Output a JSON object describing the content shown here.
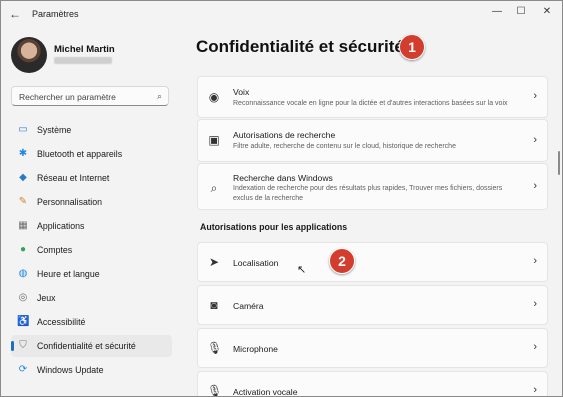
{
  "window": {
    "title": "Paramètres",
    "back_glyph": "←",
    "minimize_glyph": "—",
    "maximize_glyph": "☐",
    "close_glyph": "✕"
  },
  "user": {
    "name": "Michel Martin"
  },
  "search": {
    "placeholder": "Rechercher un paramètre"
  },
  "sidebar": {
    "items": [
      {
        "label": "Système",
        "icon": "monitor-icon",
        "glyph": "▭",
        "color": "#2d7fd3"
      },
      {
        "label": "Bluetooth et appareils",
        "icon": "bluetooth-icon",
        "glyph": "✱",
        "color": "#1e88e5"
      },
      {
        "label": "Réseau et Internet",
        "icon": "wifi-icon",
        "glyph": "◆",
        "color": "#2a79c9"
      },
      {
        "label": "Personnalisation",
        "icon": "brush-icon",
        "glyph": "✎",
        "color": "#d9822b"
      },
      {
        "label": "Applications",
        "icon": "apps-icon",
        "glyph": "▦",
        "color": "#6b6b6b"
      },
      {
        "label": "Comptes",
        "icon": "person-icon",
        "glyph": "●",
        "color": "#2fa35f"
      },
      {
        "label": "Heure et langue",
        "icon": "globe-clock-icon",
        "glyph": "◍",
        "color": "#1e88e5"
      },
      {
        "label": "Jeux",
        "icon": "gamepad-icon",
        "glyph": "◎",
        "color": "#6b6b6b"
      },
      {
        "label": "Accessibilité",
        "icon": "accessibility-icon",
        "glyph": "♿",
        "color": "#1e88e5"
      },
      {
        "label": "Confidentialité et sécurité",
        "icon": "shield-icon",
        "glyph": "⛉",
        "color": "#7a7a7a"
      },
      {
        "label": "Windows Update",
        "icon": "update-icon",
        "glyph": "⟳",
        "color": "#1e88e5"
      }
    ],
    "active_index": 9
  },
  "main": {
    "title": "Confidentialité et sécurité",
    "cards_top": [
      {
        "title": "Voix",
        "desc": "Reconnaissance vocale en ligne pour la dictée et d'autres interactions basées sur la voix",
        "icon": "voice-icon",
        "glyph": "◉"
      },
      {
        "title": "Autorisations de recherche",
        "desc": "Filtre adulte, recherche de contenu sur le cloud, historique de recherche",
        "icon": "search-permissions-icon",
        "glyph": "▣"
      },
      {
        "title": "Recherche dans Windows",
        "desc": "Indexation de recherche pour des résultats plus rapides, Trouver mes fichiers, dossiers exclus de la recherche",
        "icon": "windows-search-icon",
        "glyph": "⌕"
      }
    ],
    "section_heading": "Autorisations pour les applications",
    "cards_apps": [
      {
        "title": "Localisation",
        "icon": "location-icon",
        "glyph": "➤"
      },
      {
        "title": "Caméra",
        "icon": "camera-icon",
        "glyph": "◙"
      },
      {
        "title": "Microphone",
        "icon": "microphone-icon",
        "glyph": "🎙"
      },
      {
        "title": "Activation vocale",
        "icon": "voice-activation-icon",
        "glyph": "🎙"
      }
    ],
    "chevron": "›"
  },
  "annotations": {
    "badge1": "1",
    "badge2": "2"
  },
  "colors": {
    "accent": "#1a6fc4",
    "badge": "#d33d2e"
  }
}
